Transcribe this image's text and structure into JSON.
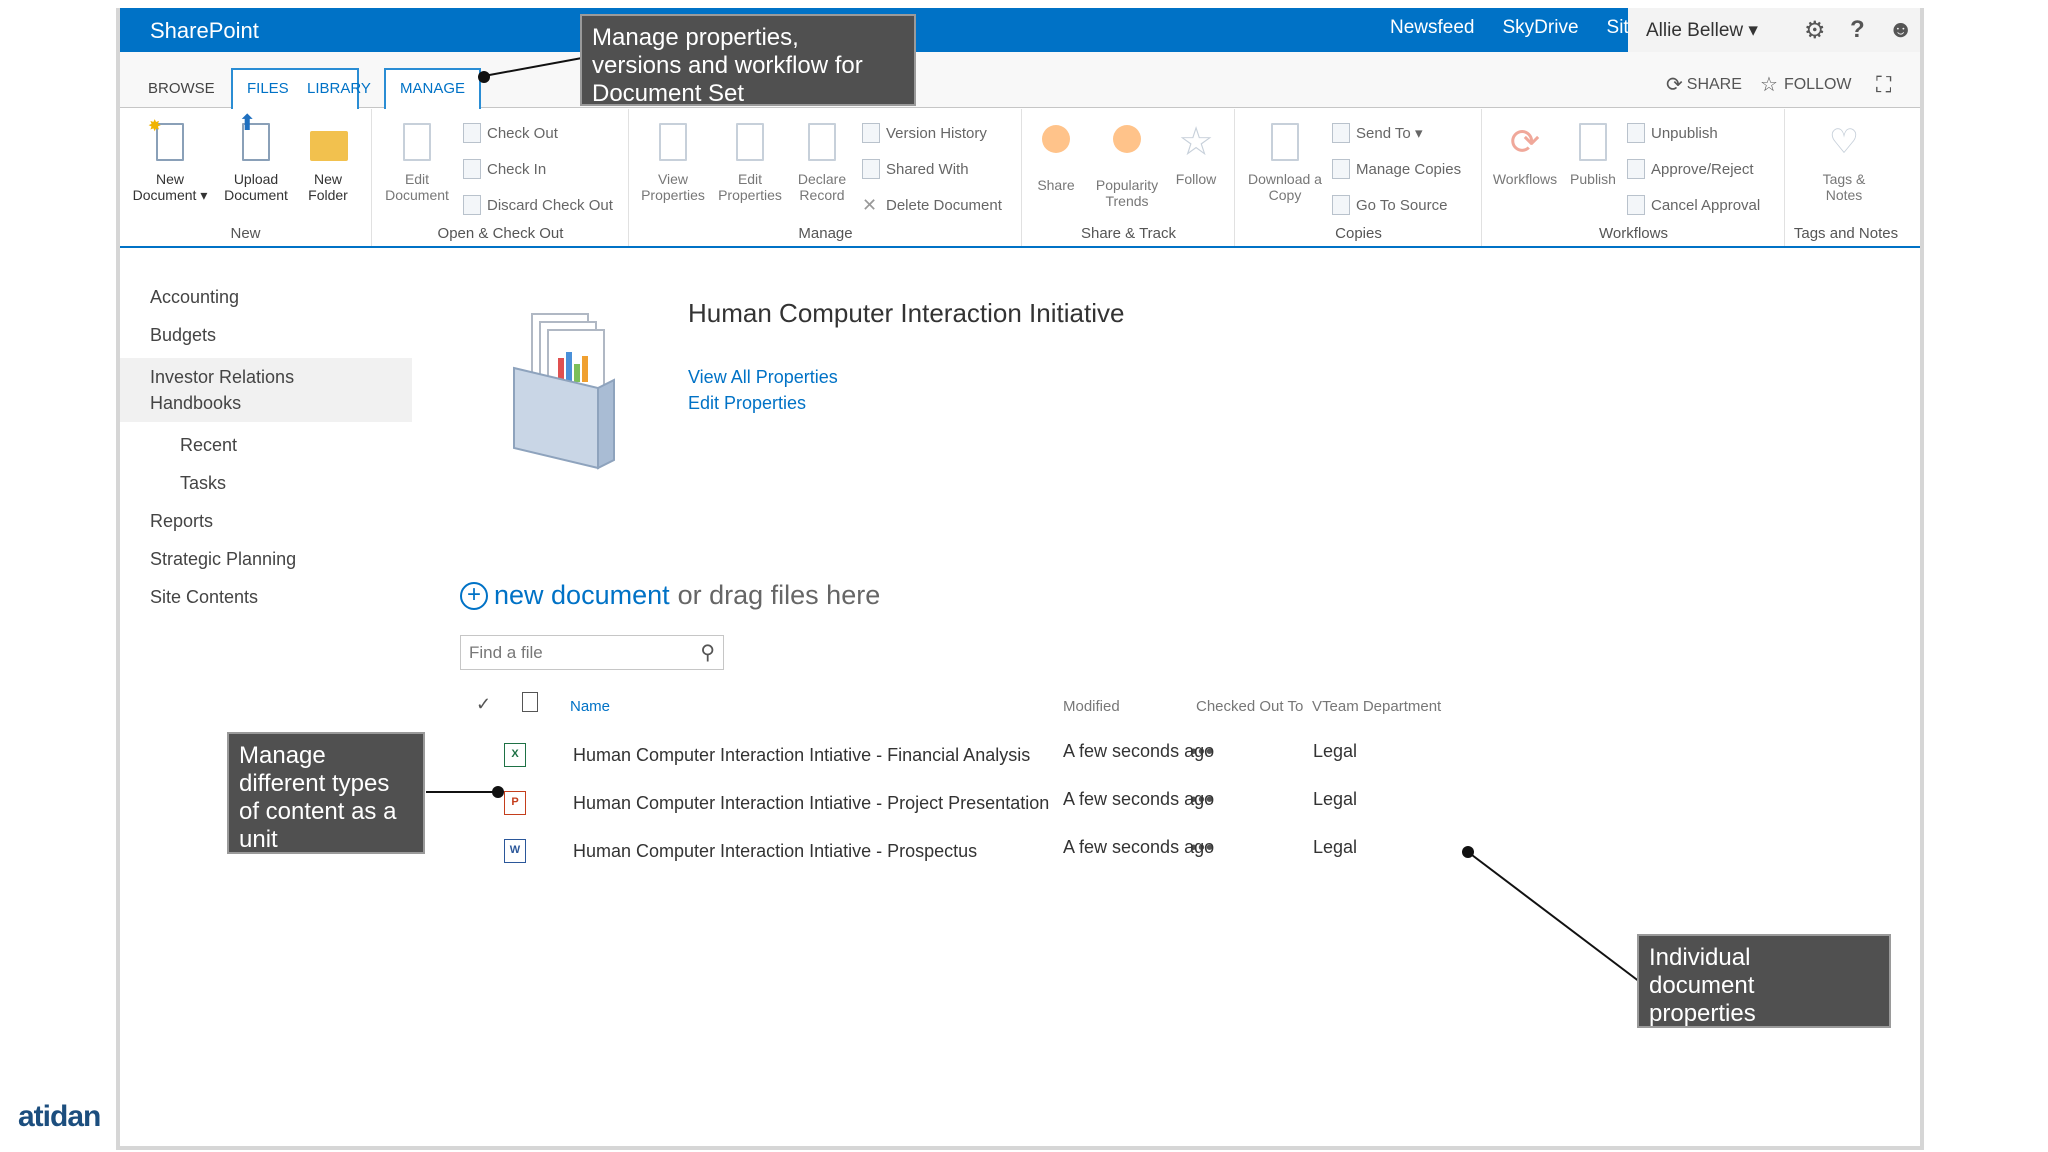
{
  "suitebar": {
    "brand": "SharePoint",
    "links": [
      "Newsfeed",
      "SkyDrive",
      "Sites"
    ],
    "user": "Allie Bellew ▾"
  },
  "tabs": {
    "browse": "BROWSE",
    "files": "FILES",
    "library": "LIBRARY",
    "manage": "MANAGE",
    "share": "SHARE",
    "follow": "FOLLOW"
  },
  "ribbon": {
    "new": {
      "label": "New",
      "new_document": [
        "New",
        "Document ▾"
      ],
      "upload_document": [
        "Upload",
        "Document"
      ],
      "new_folder": [
        "New",
        "Folder"
      ]
    },
    "open_checkout": {
      "label": "Open & Check Out",
      "edit_document": [
        "Edit",
        "Document"
      ],
      "check_out": "Check Out",
      "check_in": "Check In",
      "discard_check_out": "Discard Check Out"
    },
    "manage": {
      "label": "Manage",
      "view_properties": [
        "View",
        "Properties"
      ],
      "edit_properties": [
        "Edit",
        "Properties"
      ],
      "declare_record": [
        "Declare",
        "Record"
      ],
      "version_history": "Version History",
      "shared_with": "Shared With",
      "delete_document": "Delete Document"
    },
    "share_track": {
      "label": "Share & Track",
      "share": "Share",
      "popularity_trends": [
        "Popularity",
        "Trends"
      ],
      "follow": "Follow"
    },
    "copies": {
      "label": "Copies",
      "download_copy": [
        "Download a",
        "Copy"
      ],
      "send_to": "Send To ▾",
      "manage_copies": "Manage Copies",
      "go_to_source": "Go To Source"
    },
    "workflows": {
      "label": "Workflows",
      "workflows": "Workflows",
      "publish": "Publish",
      "unpublish": "Unpublish",
      "approve_reject": "Approve/Reject",
      "cancel_approval": "Cancel Approval"
    },
    "tags_notes": {
      "label": "Tags and Notes",
      "tags_notes": [
        "Tags &",
        "Notes"
      ]
    }
  },
  "leftnav": {
    "accounting": "Accounting",
    "budgets": "Budgets",
    "investor_relations": [
      "Investor Relations",
      "Handbooks"
    ],
    "recent": "Recent",
    "tasks": "Tasks",
    "reports": "Reports",
    "strategic_planning": "Strategic Planning",
    "site_contents": "Site Contents"
  },
  "docset": {
    "title": "Human Computer Interaction Initiative",
    "view_all": "View All Properties",
    "edit": "Edit Properties"
  },
  "list": {
    "new_document": "new document",
    "drag_text": "or drag files here",
    "search_placeholder": "Find a file",
    "columns": {
      "name": "Name",
      "modified": "Modified",
      "checked_out": "Checked Out To",
      "vteam": "VTeam Department"
    },
    "rows": [
      {
        "name": "Human Computer Interaction Intiative - Financial Analysis",
        "modified": "A few seconds ago",
        "dept": "Legal",
        "type": "X"
      },
      {
        "name": "Human Computer Interaction Intiative - Project Presentation",
        "modified": "A few seconds ago",
        "dept": "Legal",
        "type": "P"
      },
      {
        "name": "Human Computer Interaction Intiative - Prospectus",
        "modified": "A few seconds ago",
        "dept": "Legal",
        "type": "W"
      }
    ]
  },
  "callouts": {
    "manage_docset": [
      "Manage properties,",
      "versions and workflow for",
      "Document Set"
    ],
    "manage_types": [
      "Manage",
      "different types",
      "of content as a",
      "unit"
    ],
    "individual": [
      "Individual",
      "document",
      "properties"
    ]
  },
  "logo": "atidan",
  "colors": {
    "suitebar": "#0072c6",
    "link": "#0072c6",
    "callout": "#505050"
  }
}
